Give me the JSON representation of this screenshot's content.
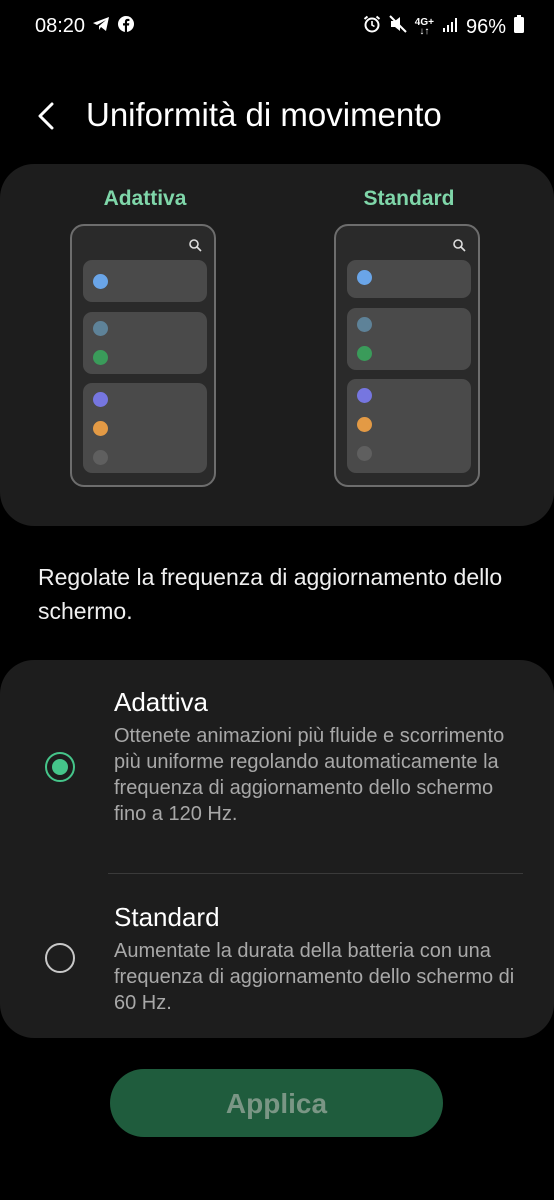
{
  "status_bar": {
    "time": "08:20",
    "left_icons": [
      "telegram-icon",
      "facebook-icon"
    ],
    "right_icons": [
      "alarm-icon",
      "mute-icon",
      "4g-plus-icon",
      "signal-icon"
    ],
    "network_label": "4G+",
    "battery": "96%"
  },
  "header": {
    "title": "Uniformità di movimento",
    "back_icon": "chevron-left-icon"
  },
  "preview": {
    "left_label": "Adattiva",
    "right_label": "Standard",
    "dot_colors": [
      "#6aa5e8",
      "#5e8298",
      "#3a9b5a",
      "#7676e0",
      "#e39a45",
      "#5f5f5f"
    ]
  },
  "description": "Regolate la frequenza di aggiornamento dello schermo.",
  "options": [
    {
      "title": "Adattiva",
      "description": "Ottenete animazioni più fluide e scorrimento più uniforme regolando automaticamente la frequenza di aggiornamento dello schermo fino a 120 Hz.",
      "selected": true
    },
    {
      "title": "Standard",
      "description": "Aumentate la durata della batteria con una frequenza di aggiornamento dello schermo di 60 Hz.",
      "selected": false
    }
  ],
  "apply_button": "Applica",
  "colors": {
    "accent": "#45c58a",
    "preview_label": "#7fd6a9",
    "panel_bg": "#1d1d1d",
    "button_bg": "#1f5c3d"
  }
}
